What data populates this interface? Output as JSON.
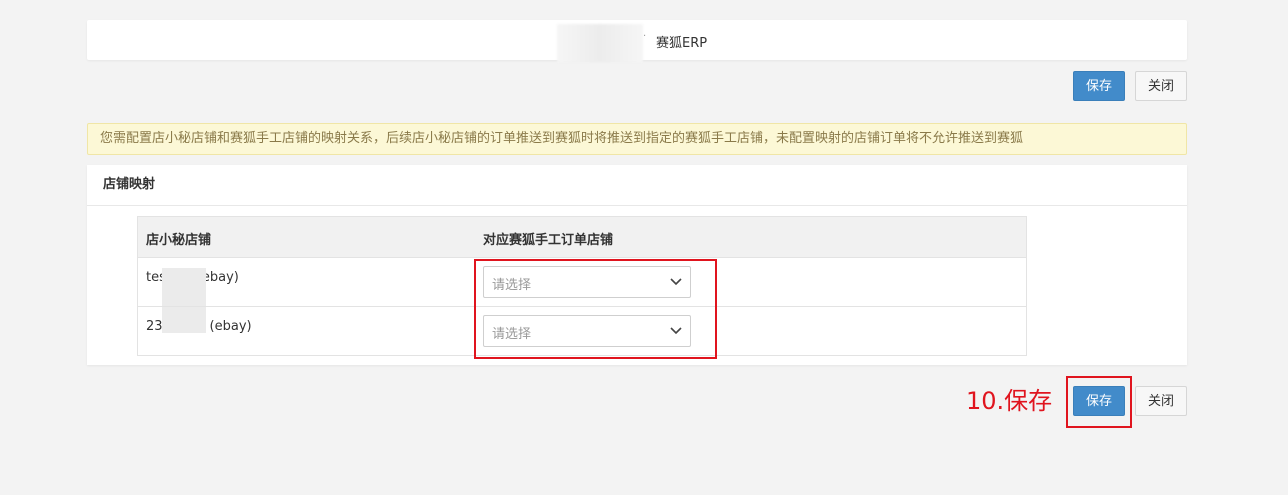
{
  "header": {
    "title": "赛狐ERP",
    "separator": "·"
  },
  "toolbar": {
    "save_label": "保存",
    "close_label": "关闭"
  },
  "notice": {
    "text": "您需配置店小秘店铺和赛狐手工店铺的映射关系，后续店小秘店铺的订单推送到赛狐时将推送到指定的赛狐手工店铺，未配置映射的店铺订单将不允许推送到赛狐"
  },
  "panel": {
    "title": "店铺映射",
    "columns": [
      "店小秘店铺",
      "对应赛狐手工订单店铺"
    ],
    "rows": [
      {
        "store_prefix": "tes",
        "store_suffix": "ebay)",
        "select_placeholder": "请选择"
      },
      {
        "store_prefix": "23",
        "store_suffix": "(ebay)",
        "select_placeholder": "请选择"
      }
    ]
  },
  "footer": {
    "save_label": "保存",
    "close_label": "关闭",
    "annotation": "10.保存"
  },
  "colors": {
    "primary": "#428bca",
    "annotation": "#e0141e",
    "notice_bg": "#fcf8d6"
  }
}
